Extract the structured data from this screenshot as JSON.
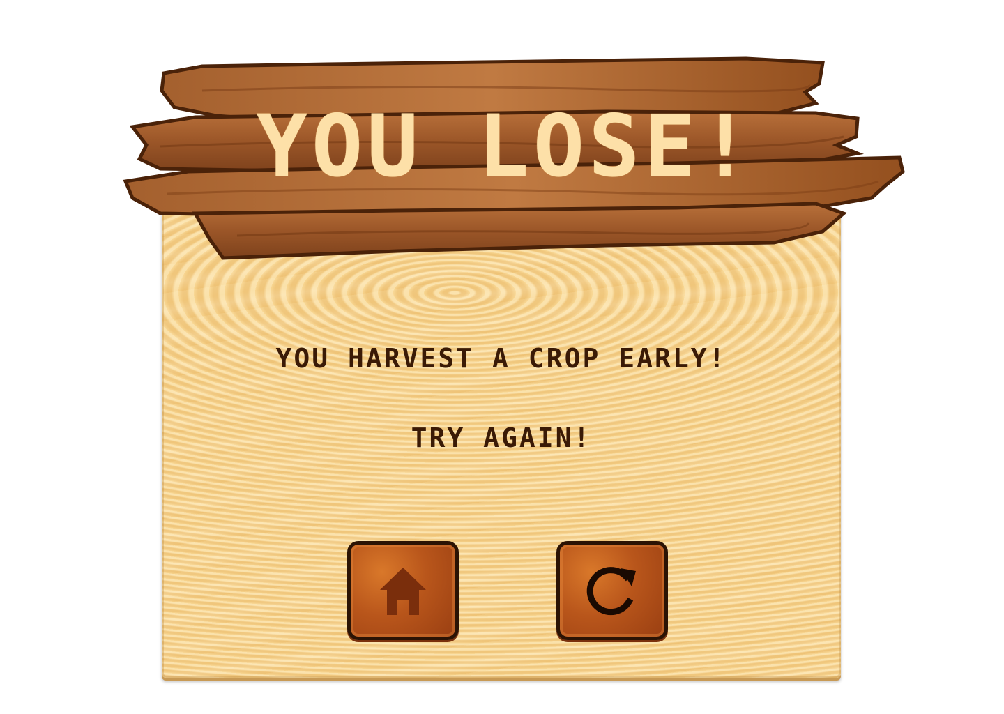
{
  "dialog": {
    "title": "YOU LOSE!",
    "message_line1": "YOU HARVEST A CROP EARLY!",
    "message_line2": "TRY AGAIN!"
  },
  "buttons": [
    {
      "name": "home",
      "icon": "house-icon"
    },
    {
      "name": "retry",
      "icon": "restart-icon"
    }
  ],
  "colors": {
    "title_text": "#fde0a8",
    "message_text": "#3a1a06",
    "board": "#f7d592",
    "plank": "#8b4a1f",
    "button": "#b9561b"
  }
}
